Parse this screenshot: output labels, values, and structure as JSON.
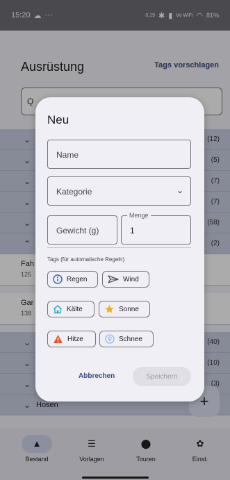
{
  "status_bar": {
    "time": "15:20",
    "network_speed": "0,19",
    "wifi_label": "Vo WiFi",
    "battery": "81%"
  },
  "app": {
    "title": "Ausrüstung",
    "suggest_tags_label": "Tags vorschlagen",
    "search_glyph": "Q",
    "rows": [
      {
        "count": "(12)"
      },
      {
        "count": "(5)"
      },
      {
        "count": "(7)"
      },
      {
        "count": "(7)"
      },
      {
        "count": "(58)"
      },
      {
        "count": "(2)"
      }
    ],
    "items": [
      {
        "label": "Fah",
        "sub": "125"
      },
      {
        "label": "Gar",
        "sub": "138"
      }
    ],
    "lower_rows": [
      {
        "count": "(40)"
      },
      {
        "count": "(10)"
      },
      {
        "count": "(3)"
      }
    ],
    "hosen_label": "Hosen",
    "fab_label": "+"
  },
  "bottom_nav": [
    {
      "label": "Bestand",
      "icon": "home-icon"
    },
    {
      "label": "Vorlagen",
      "icon": "list-icon"
    },
    {
      "label": "Touren",
      "icon": "map-pin-icon"
    },
    {
      "label": "Einst.",
      "icon": "gear-icon"
    }
  ],
  "dialog": {
    "title": "Neu",
    "name_placeholder": "Name",
    "category_placeholder": "Kategorie",
    "weight_placeholder": "Gewicht (g)",
    "quantity_label": "Menge",
    "quantity_value": "1",
    "tags_caption": "Tags (für automatische Regeln)",
    "tags": [
      {
        "label": "Regen",
        "icon": "info-circle-icon",
        "color": "#2b61c9"
      },
      {
        "label": "Wind",
        "icon": "paper-plane-icon",
        "color": "#555555"
      },
      {
        "label": "Kälte",
        "icon": "house-icon",
        "color": "#2aa3c2"
      },
      {
        "label": "Sonne",
        "icon": "star-icon",
        "color": "#f2b01e"
      },
      {
        "label": "Hitze",
        "icon": "warning-icon",
        "color": "#e6542a"
      },
      {
        "label": "Schnee",
        "icon": "location-icon",
        "color": "#8fb8e8"
      }
    ],
    "cancel_label": "Abbrechen",
    "save_label": "Speichern"
  },
  "colors": {
    "accent": "#3b4a7a",
    "list_row_bg": "#c9cfe3",
    "dialog_bg": "#f0eff6"
  }
}
